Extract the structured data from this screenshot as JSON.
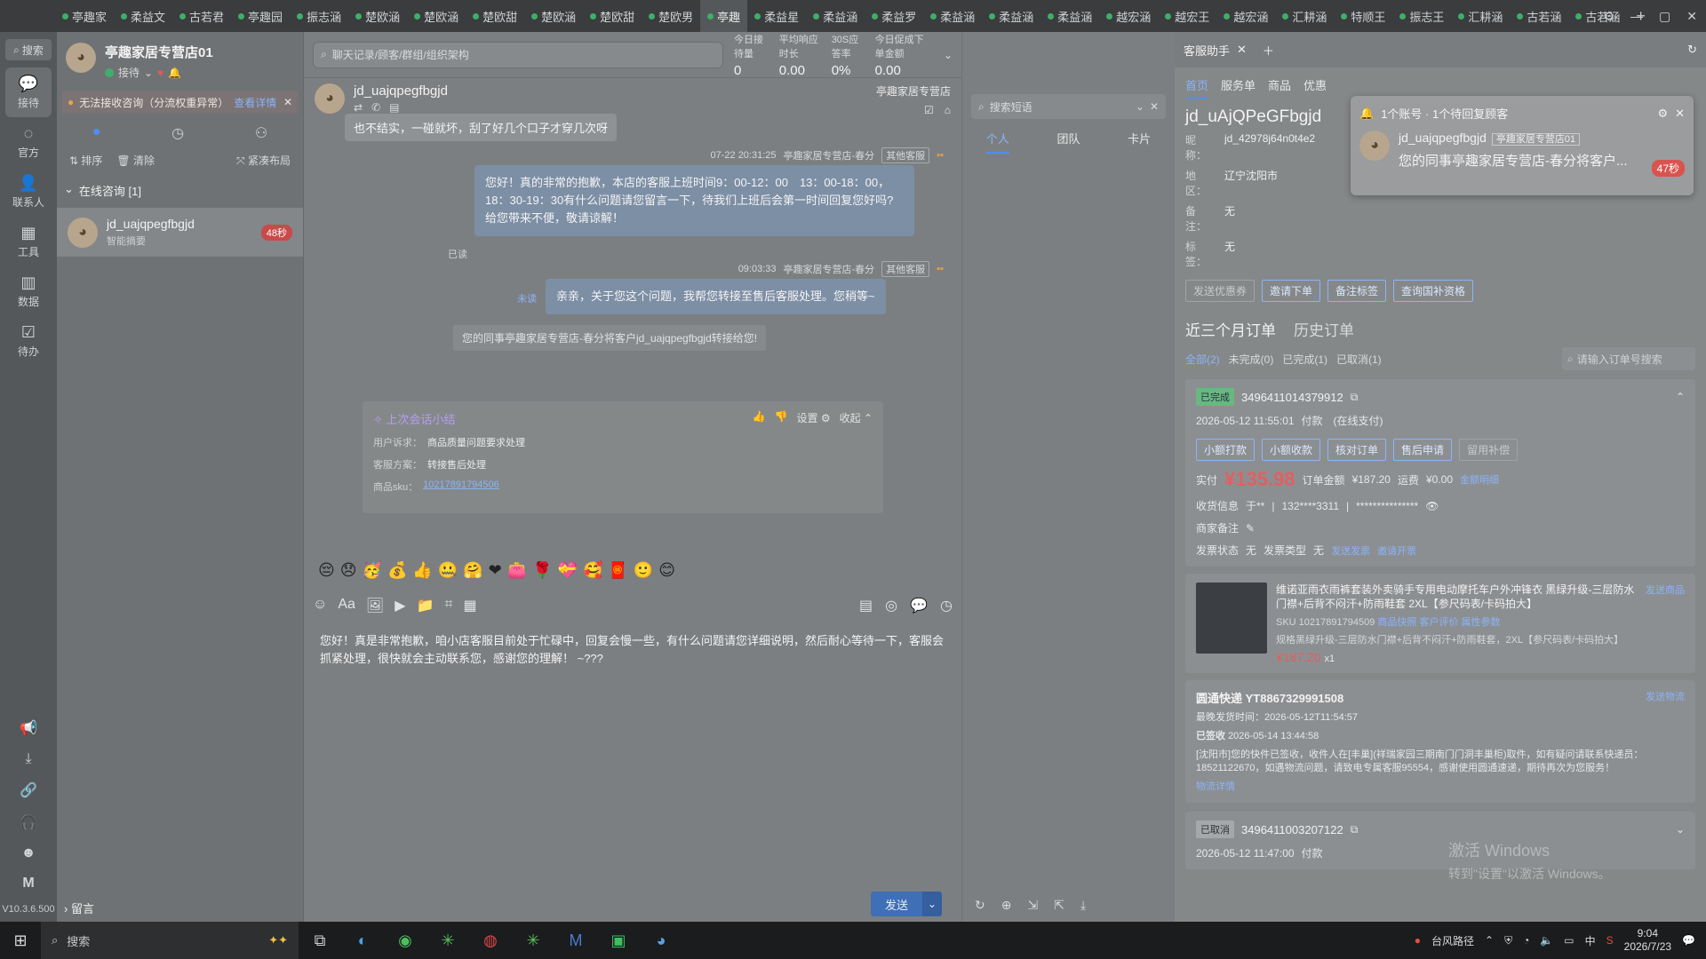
{
  "tabs": [
    {
      "label": "亭趣家"
    },
    {
      "label": "柔益文"
    },
    {
      "label": "古若君"
    },
    {
      "label": "亭趣园"
    },
    {
      "label": "振志涵"
    },
    {
      "label": "楚欧涵"
    },
    {
      "label": "楚欧涵"
    },
    {
      "label": "楚欧甜"
    },
    {
      "label": "楚欧涵"
    },
    {
      "label": "楚欧甜"
    },
    {
      "label": "楚欧男"
    },
    {
      "label": "亭趣"
    },
    {
      "label": "柔益星"
    },
    {
      "label": "柔益涵"
    },
    {
      "label": "柔益罗"
    },
    {
      "label": "柔益涵"
    },
    {
      "label": "柔益涵"
    },
    {
      "label": "柔益涵"
    },
    {
      "label": "越宏涵"
    },
    {
      "label": "越宏王"
    },
    {
      "label": "越宏涵"
    },
    {
      "label": "汇耕涵"
    },
    {
      "label": "特顺王"
    },
    {
      "label": "振志王"
    },
    {
      "label": "汇耕涵"
    },
    {
      "label": "古若涵"
    },
    {
      "label": "古若涵"
    }
  ],
  "rail": {
    "search": "搜索",
    "items": [
      {
        "icon": "chat-icon",
        "label": "接待"
      },
      {
        "icon": "official-icon",
        "label": "官方"
      },
      {
        "icon": "contacts-icon",
        "label": "联系人"
      },
      {
        "icon": "tools-icon",
        "label": "工具"
      },
      {
        "icon": "data-icon",
        "label": "数据"
      },
      {
        "icon": "todo-icon",
        "label": "待办"
      }
    ],
    "version": "V10.3.6.500"
  },
  "sessions": {
    "shop_name": "亭趣家居专营店01",
    "status": "接待",
    "warning": "无法接收咨询（分流权重异常）",
    "warning_link": "查看详情",
    "tool_sort": "排序",
    "tool_clear": "清除",
    "tool_layout": "紧凑布局",
    "group": "在线咨询 [1]",
    "item_name": "jd_uajqpegfbgjd",
    "item_sub": "智能摘要",
    "item_badge": "48秒",
    "leave": "留言"
  },
  "chat": {
    "search_placeholder": "聊天记录/顾客/群组/组织架构",
    "stats": [
      {
        "k": "今日接待量",
        "v": "0"
      },
      {
        "k": "平均响应时长",
        "v": "0.00"
      },
      {
        "k": "30S应答率",
        "v": "0%"
      },
      {
        "k": "今日促成下单金额",
        "v": "0.00"
      }
    ],
    "conv_name": "jd_uajqpegfbgjd",
    "conv_shop": "亭趣家居专营店",
    "msg_customer": "也不结实，一碰就坏，刮了好几个口子才穿几次呀",
    "meta1_time": "07-22 20:31:25",
    "meta1_from": "亭趣家居专营店-春分",
    "meta_tag": "其他客服",
    "msg_bot1": "您好！真的非常的抱歉，本店的客服上班时间9：00-12：00　13：00-18：00，18：30-19：30有什么问题请您留言一下，待我们上班后会第一时间回复您好吗?给您带来不便，敬请谅解！",
    "read": "已读",
    "meta2_time": "09:03:33",
    "meta2_from": "亭趣家居专营店-春分",
    "msg_bot2": "亲亲，关于您这个问题，我帮您转接至售后客服处理。您稍等~",
    "unread": "未读",
    "sys_msg": "您的同事亭趣家居专营店-春分将客户jd_uajqpegfbgjd转接给您!",
    "summary": {
      "title": "上次会话小结",
      "settings": "设置",
      "collapse": "收起",
      "row1_k": "用户诉求：",
      "row1_v": "商品质量问题要求处理",
      "row2_k": "客服方案：",
      "row2_v": "转接售后处理",
      "row3_k": "商品sku：",
      "row3_v": "10217891794506"
    },
    "emojis": [
      "😔",
      "😞",
      "🥳",
      "💰",
      "👍",
      "🤐",
      "🤗",
      "❤",
      "👛",
      "🌹",
      "💝",
      "🥰",
      "🧧",
      "🙂",
      "😊"
    ],
    "input_text": "您好！真是非常抱歉，咱小店客服目前处于忙碌中，回复会慢一些，有什么问题请您详细说明，然后耐心等待一下，客服会抓紧处理，很快就会主动联系您，感谢您的理解！ ~???",
    "send": "发送"
  },
  "quick": {
    "search_placeholder": "搜索短语",
    "tabs": [
      "个人",
      "团队",
      "卡片"
    ]
  },
  "right": {
    "tab_title": "客服助手",
    "nav": [
      "首页",
      "服务单",
      "商品",
      "优惠"
    ],
    "buyer_name": "jd_uAjQPeGFbgjd",
    "nick_k": "昵称：",
    "nick_v": "jd_42978j64n0t4e2",
    "region_k": "地区：",
    "region_v": "辽宁沈阳市",
    "remark_k": "备注：",
    "remark_v": "无",
    "tag_k": "标签：",
    "tag_v": "无",
    "buyer_btns": [
      "发送优惠券",
      "邀请下单",
      "备注标签",
      "查询国补资格"
    ],
    "orders_title": "近三个月订单",
    "orders_history": "历史订单",
    "filters": [
      "全部(2)",
      "未完成(0)",
      "已完成(1)",
      "已取消(1)"
    ],
    "order_search": "请输入订单号搜索",
    "order1": {
      "status": "已完成",
      "id": "3496411014379912",
      "time": "2026-05-12 11:55:01",
      "pay": "付款　(在线支付)",
      "btns": [
        "小额打款",
        "小额收款",
        "核对订单",
        "售后申请",
        "留用补偿"
      ],
      "paid_k": "实付",
      "paid": "¥135.98",
      "total_k": "订单金额",
      "total": "¥187.20",
      "ship_k": "运费",
      "ship": "¥0.00",
      "detail": "金额明细",
      "recv_k": "收货信息",
      "recv_name": "于**",
      "recv_phone": "132****3311",
      "recv_addr": "***************",
      "merchant_note": "商家备注",
      "invoice_k": "发票状态",
      "invoice_v": "无",
      "invtype_k": "发票类型",
      "invtype_v": "无",
      "send_invoice": "发送发票",
      "invite_invoice": "邀请开票"
    },
    "product": {
      "title": "维诺亚雨衣雨裤套装外卖骑手专用电动摩托车户外冲锋衣 黑绿升级-三层防水门襟+后背不闷汗+防雨鞋套 2XL【参尺码表/卡码拍大】",
      "sku": "SKU 10217891794509",
      "links": [
        "商品快照",
        "客户评价",
        "属性参数"
      ],
      "spec": "规格黑绿升级-三层防水门襟+后背不闷汗+防雨鞋套，2XL【参尺码表/卡码拍大】",
      "price": "¥187.20",
      "qty": "x1",
      "send": "发送商品"
    },
    "logistics": {
      "title": "圆通快递 YT8867329991508",
      "send": "发送物流",
      "latest_k": "最晚发货时间：",
      "latest": "2026-05-12T11:54:57",
      "signed": "已签收",
      "signed_time": "2026-05-14 13:44:58",
      "detail": "[沈阳市]您的快件已签收，收件人在[丰巢](祥瑞家园三期南门门洞丰巢柜)取件，如有疑问请联系快递员：18521122670，如遇物流问题，请致电专属客服95554，感谢使用圆通速递，期待再次为您服务！",
      "more": "物流详情"
    },
    "order2": {
      "status": "已取消",
      "id": "3496411003207122",
      "time": "2026-05-12 11:47:00",
      "pay": "付款"
    }
  },
  "popup": {
    "title": "1个账号 · 1个待回复顾客",
    "name": "jd_uajqpegfbgjd",
    "tag": "亭趣家居专营店01",
    "msg": "您的同事亭趣家居专营店-春分将客户...",
    "seconds": "47秒"
  },
  "taskbar": {
    "search": "搜索",
    "weather": "台风路径",
    "ime": "中",
    "time": "9:04",
    "date": "2026/7/23"
  },
  "watermark": {
    "line1": "激活 Windows",
    "line2": "转到\"设置\"以激活 Windows。"
  }
}
